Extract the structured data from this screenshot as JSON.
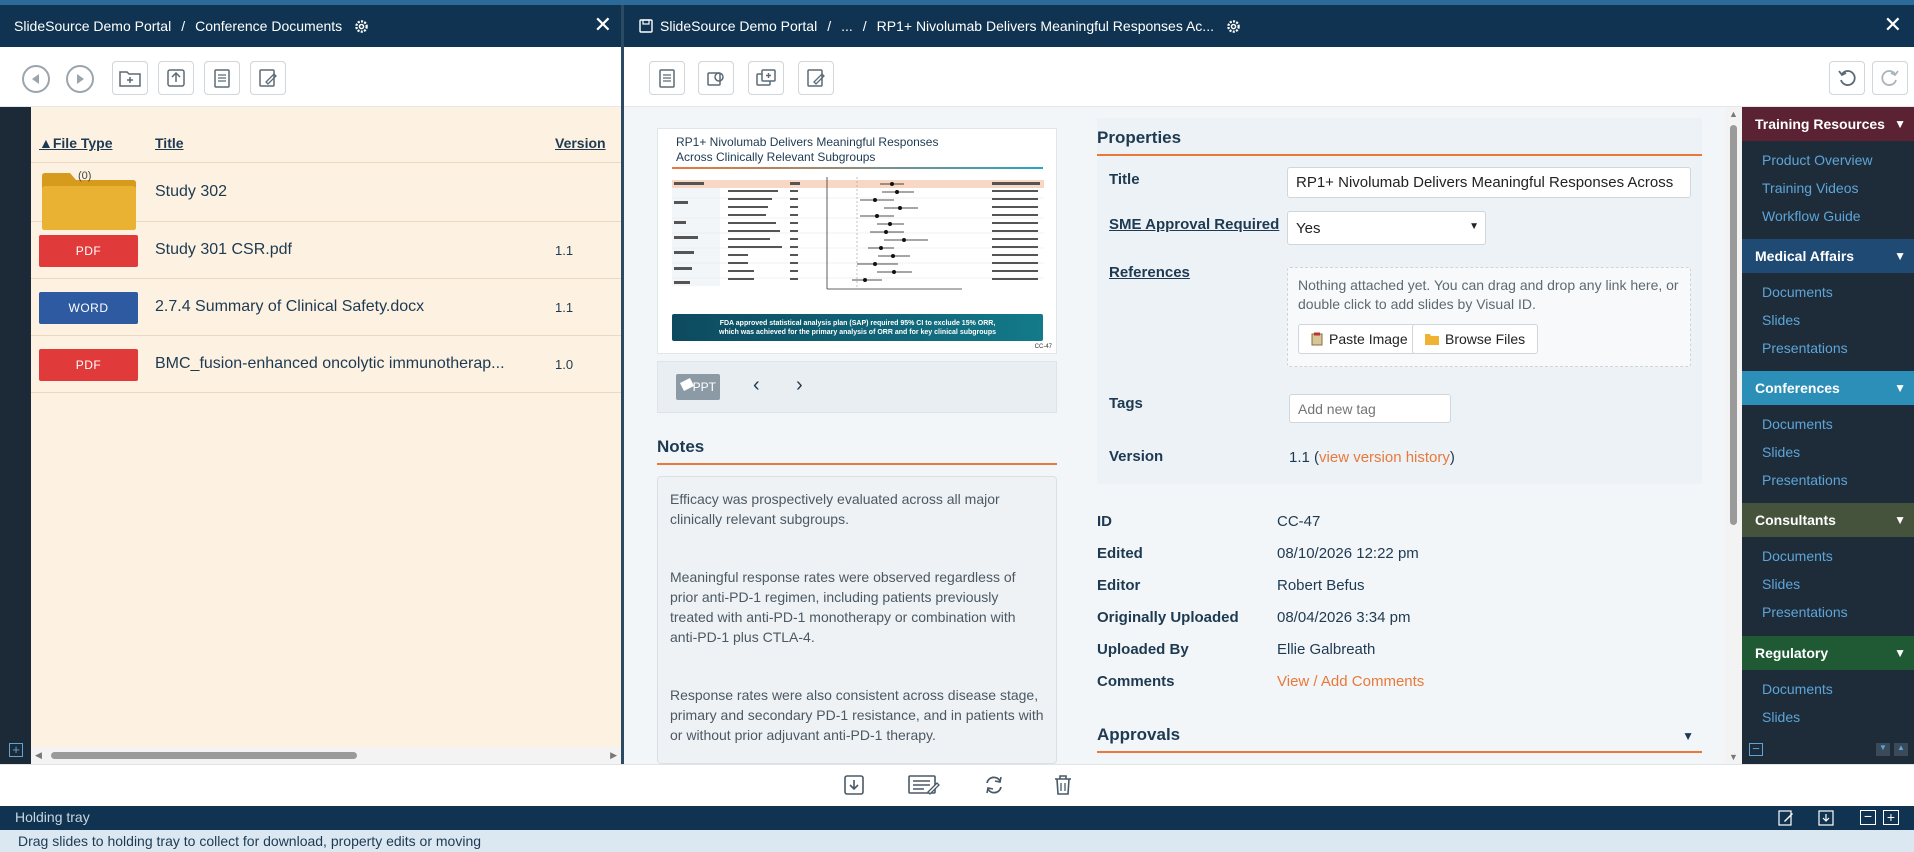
{
  "left_header": {
    "portal": "SlideSource Demo Portal",
    "separator": "/",
    "section": "Conference Documents"
  },
  "right_header": {
    "portal": "SlideSource Demo Portal",
    "separator": "/",
    "ellipsis": "...",
    "separator2": "/",
    "title": "RP1+ Nivolumab Delivers Meaningful Responses Ac..."
  },
  "file_list": {
    "columns": {
      "type": "▲File Type",
      "title": "Title",
      "version": "Version"
    },
    "rows": [
      {
        "kind": "folder",
        "badge": "(0)",
        "title": "Study 302",
        "version": ""
      },
      {
        "kind": "PDF",
        "badge": "PDF",
        "title": "Study 301 CSR.pdf",
        "version": "1.1",
        "color": "#e03a3a"
      },
      {
        "kind": "WORD",
        "badge": "WORD",
        "title": "2.7.4 Summary of Clinical Safety.docx",
        "version": "1.1",
        "color": "#2d5aa0"
      },
      {
        "kind": "PDF",
        "badge": "PDF",
        "title": "BMC_fusion-enhanced oncolytic immunotherap...",
        "version": "1.0",
        "color": "#e03a3a"
      }
    ]
  },
  "slide_preview": {
    "title_line1": "RP1+ Nivolumab Delivers Meaningful Responses",
    "title_line2": "Across Clinically Relevant Subgroups",
    "banner_line1": "FDA approved statistical analysis plan (SAP) required 95% CI to exclude 15% ORR,",
    "banner_line2": "which was achieved for the primary analysis of ORR and for key clinical subgroups",
    "slide_id": "CC-47",
    "ppt_label": "PPT"
  },
  "notes": {
    "heading": "Notes",
    "paragraphs": [
      "Efficacy was prospectively evaluated across all major clinically relevant subgroups.",
      "Meaningful response rates were observed regardless of prior anti-PD-1 regimen, including patients previously treated with anti-PD-1 monotherapy or combination with anti-PD-1 plus CTLA-4.",
      "Response rates were also consistent across disease stage, primary and secondary PD-1 resistance, and in patients with or without prior adjuvant anti-PD-1 therapy."
    ]
  },
  "properties": {
    "heading": "Properties",
    "title_label": "Title",
    "title_value": "RP1+ Nivolumab Delivers Meaningful Responses Across",
    "sme_label": "SME Approval Required",
    "sme_value": "Yes",
    "refs_label": "References",
    "refs_text": "Nothing attached yet. You can drag and drop any link here, or double click to add slides by Visual ID.",
    "paste_label": "Paste Image",
    "browse_label": "Browse Files",
    "tags_label": "Tags",
    "tags_placeholder": "Add new tag",
    "version_label": "Version",
    "version_value": "1.1 (",
    "version_link": "view version history",
    "version_close": ")"
  },
  "info": {
    "id_label": "ID",
    "id_value": "CC-47",
    "edited_label": "Edited",
    "edited_value": "08/10/2026 12:22 pm",
    "editor_label": "Editor",
    "editor_value": "Robert Befus",
    "uploaded_label": "Originally Uploaded",
    "uploaded_value": "08/04/2026 3:34 pm",
    "uploader_label": "Uploaded By",
    "uploader_value": "Ellie Galbreath",
    "comments_label": "Comments",
    "comments_link": "View / Add Comments"
  },
  "approvals": {
    "heading": "Approvals"
  },
  "sidebar": {
    "groups": [
      {
        "label": "Training Resources",
        "color": "#5a2233",
        "items": [
          "Product Overview",
          "Training Videos",
          "Workflow Guide"
        ]
      },
      {
        "label": "Medical Affairs",
        "color": "#1f4a73",
        "items": [
          "Documents",
          "Slides",
          "Presentations"
        ]
      },
      {
        "label": "Conferences",
        "color": "#2b8fb8",
        "items": [
          "Documents",
          "Slides",
          "Presentations"
        ]
      },
      {
        "label": "Consultants",
        "color": "#45533d",
        "items": [
          "Documents",
          "Slides",
          "Presentations"
        ]
      },
      {
        "label": "Regulatory",
        "color": "#1f5a35",
        "items": [
          "Documents",
          "Slides"
        ]
      }
    ]
  },
  "tray": {
    "label": "Holding tray",
    "message": "Drag slides to holding tray to collect for download, property edits or moving"
  }
}
